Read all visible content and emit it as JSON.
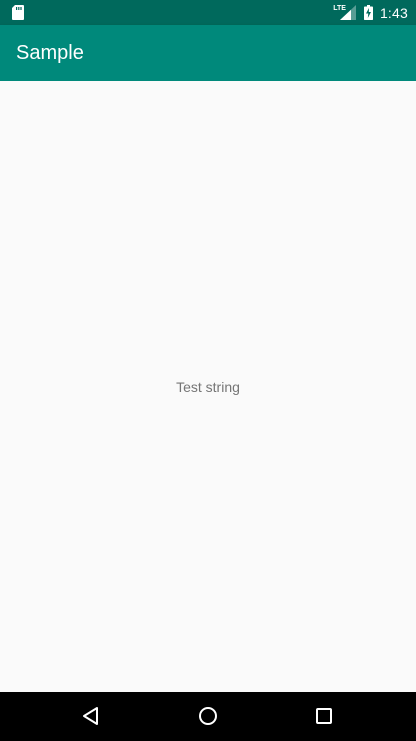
{
  "status_bar": {
    "network_label": "LTE",
    "time": "1:43",
    "icons": [
      "sd-card-icon",
      "signal-icon",
      "battery-charging-icon"
    ]
  },
  "app_bar": {
    "title": "Sample"
  },
  "content": {
    "text": "Test string"
  },
  "nav_bar": {
    "icons": [
      "back-icon",
      "home-icon",
      "recents-icon"
    ]
  },
  "colors": {
    "status_bar": "#00695c",
    "app_bar": "#00897b",
    "background": "#fafafa",
    "text_secondary": "#757575",
    "nav_bar": "#000000"
  }
}
